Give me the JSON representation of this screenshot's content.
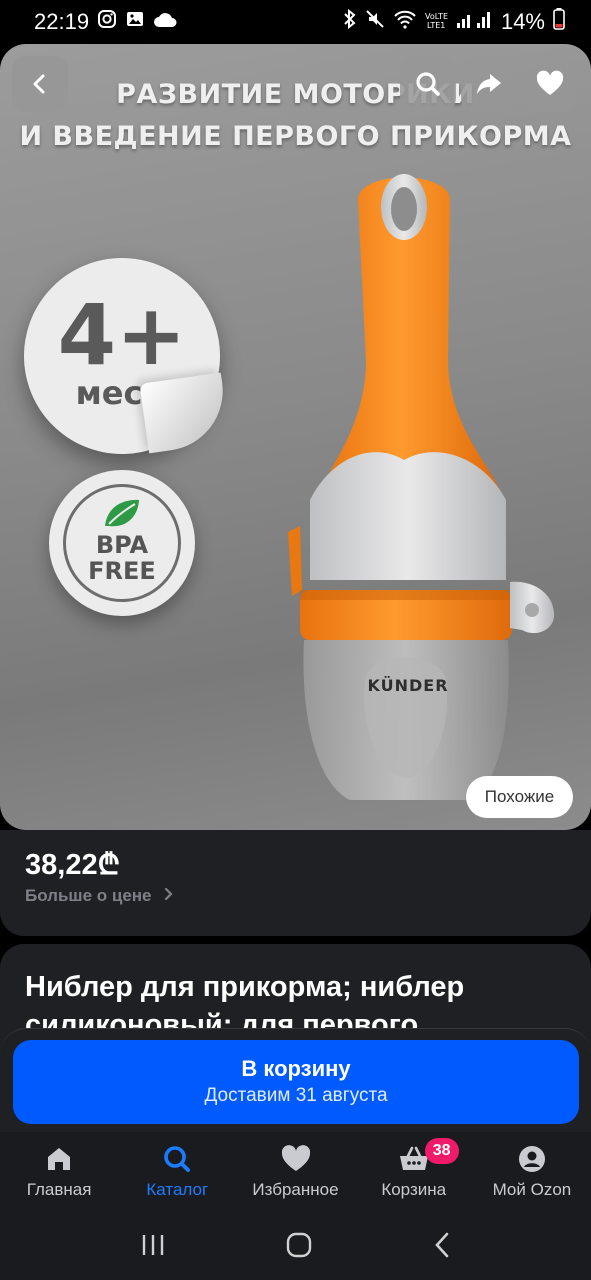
{
  "status_bar": {
    "time": "22:19",
    "battery": "14%",
    "left_icons": [
      "instagram-icon",
      "gallery-icon",
      "cloud-icon"
    ],
    "right_icons": [
      "bluetooth-icon",
      "mute-icon",
      "wifi-icon",
      "volte-icon",
      "signal-icon",
      "battery-icon"
    ]
  },
  "hero": {
    "title_line1": "РАЗВИТИЕ МОТОРИКИ",
    "title_line2": "И ВВЕДЕНИЕ ПЕРВОГО ПРИКОРМА",
    "age_number": "4+",
    "age_unit": "мес",
    "bpa_line1": "BPA",
    "bpa_line2": "FREE",
    "brand": "KÜNDER",
    "similar_label": "Похожие",
    "overlay_icons": [
      "back-icon",
      "search-icon",
      "share-icon",
      "heart-icon"
    ]
  },
  "price": {
    "amount": "38,22₾",
    "more_label": "Больше о цене"
  },
  "product": {
    "title": "Ниблер для прикорма; ниблер силиконовый; для первого"
  },
  "cart": {
    "label": "В корзину",
    "delivery": "Доставим 31 августа"
  },
  "bottom_nav": {
    "items": [
      {
        "label": "Главная",
        "icon": "home-icon"
      },
      {
        "label": "Каталог",
        "icon": "search-icon",
        "active": true
      },
      {
        "label": "Избранное",
        "icon": "heart-icon"
      },
      {
        "label": "Корзина",
        "icon": "basket-icon",
        "badge": "38"
      },
      {
        "label": "Мой Ozon",
        "icon": "profile-icon"
      }
    ]
  },
  "colors": {
    "accent": "#005bff",
    "active_nav": "#1c7cff",
    "badge": "#f01a6a",
    "nibbler_orange": "#f7891f",
    "card_bg": "#1f2024"
  }
}
